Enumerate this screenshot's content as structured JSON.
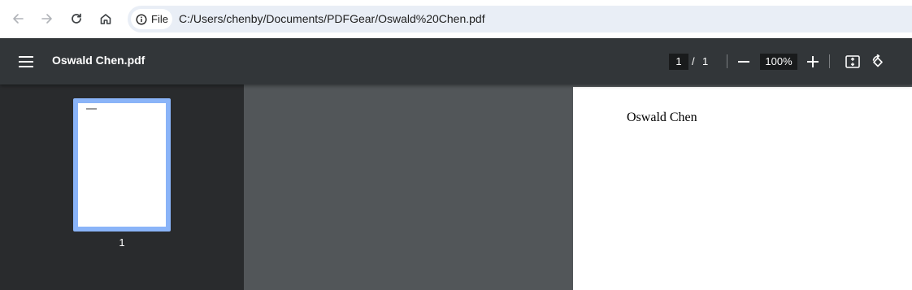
{
  "browser": {
    "site_chip_label": "File",
    "url": "C:/Users/chenby/Documents/PDFGear/Oswald%20Chen.pdf",
    "icons": [
      "back-icon",
      "forward-icon",
      "reload-icon",
      "home-icon",
      "info-icon"
    ]
  },
  "toolbar": {
    "title": "Oswald Chen.pdf",
    "page_current": "1",
    "page_separator": "/",
    "page_total": "1",
    "zoom": "100%",
    "icons": [
      "menu-icon",
      "zoom-out-icon",
      "zoom-in-icon",
      "fit-page-icon",
      "rotate-icon"
    ]
  },
  "sidebar": {
    "thumbnails": [
      {
        "label": "1",
        "selected": true
      }
    ]
  },
  "document": {
    "text": "Oswald Chen"
  },
  "colors": {
    "toolbar_bg": "#323639",
    "sidebar_bg": "#292b2d",
    "viewer_bg": "#525659",
    "thumbnail_selected": "#8ab4f8",
    "omnibox_bg": "#e9eef6"
  }
}
